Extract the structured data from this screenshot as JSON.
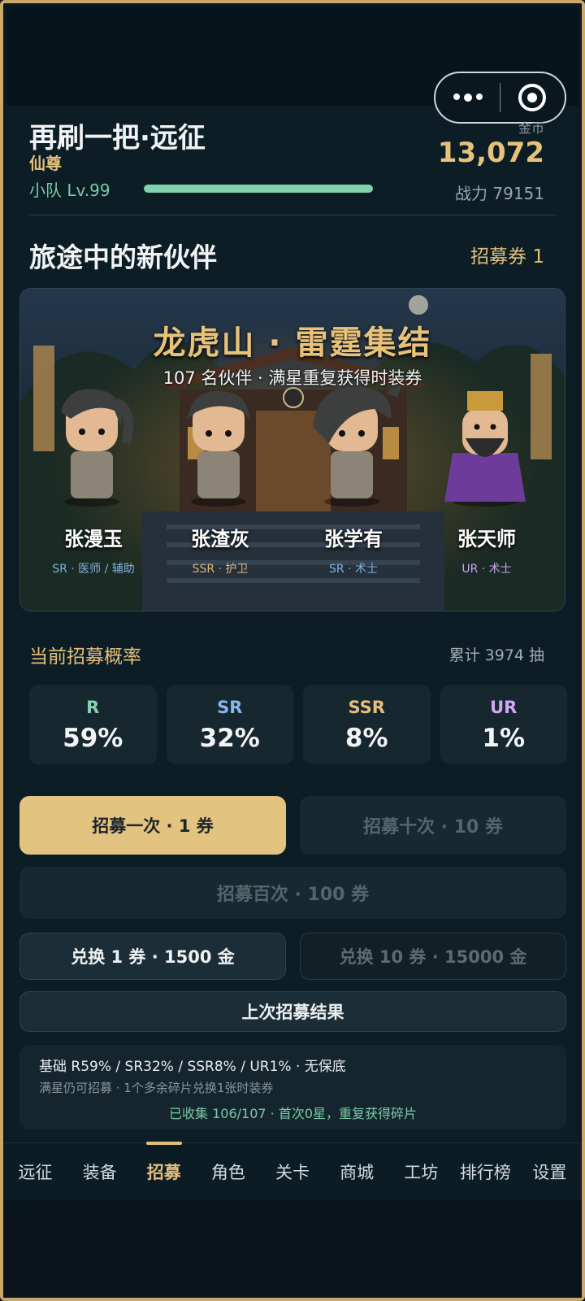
{
  "header": {
    "title": "再刷一把·远征",
    "rank": "仙尊",
    "team_level": "小队 Lv.99",
    "level_progress": 1.0,
    "coin_label": "金币",
    "coin_value": "13,072",
    "power": "战力 79151"
  },
  "section": {
    "title": "旅途中的新伙伴",
    "ticket": "招募券 1"
  },
  "banner": {
    "title": "龙虎山 · 雷霆集结",
    "subtitle": "107 名伙伴 · 满星重复获得时装券",
    "heroes": [
      {
        "name": "张漫玉",
        "role": "SR · 医师 / 辅助",
        "role_color": "#7fb2e0"
      },
      {
        "name": "张渣灰",
        "role": "SSR · 护卫",
        "role_color": "#d9b77a"
      },
      {
        "name": "张学有",
        "role": "SR · 术士",
        "role_color": "#7fb2e0"
      },
      {
        "name": "张天师",
        "role": "UR · 术士",
        "role_color": "#c8a4f0"
      }
    ]
  },
  "rates": {
    "title": "当前招募概率",
    "total": "累计 3974 抽",
    "items": [
      {
        "label": "R",
        "pct": "59%",
        "color": "#86d3b3"
      },
      {
        "label": "SR",
        "pct": "32%",
        "color": "#86b7ea"
      },
      {
        "label": "SSR",
        "pct": "8%",
        "color": "#e4bf79"
      },
      {
        "label": "UR",
        "pct": "1%",
        "color": "#cfa9f5"
      }
    ]
  },
  "buttons": {
    "once": "招募一次 · 1 券",
    "ten": "招募十次 · 10 券",
    "hundred": "招募百次 · 100 券",
    "exchange1": "兑换 1 券 · 1500 金",
    "exchange10": "兑换 10 券 · 15000 金",
    "last_result": "上次招募结果"
  },
  "info": {
    "line1": "基础 R59% / SR32% / SSR8% / UR1% · 无保底",
    "line2": "满星仍可招募 · 1个多余碎片兑换1张时装券",
    "line3": "已收集 106/107 · 首次0星，重复获得碎片"
  },
  "tabs": [
    "远征",
    "装备",
    "招募",
    "角色",
    "关卡",
    "商城",
    "工坊",
    "排行榜",
    "设置"
  ],
  "active_tab": 2,
  "icons": [
    "more-dots-icon",
    "close-target-icon"
  ]
}
